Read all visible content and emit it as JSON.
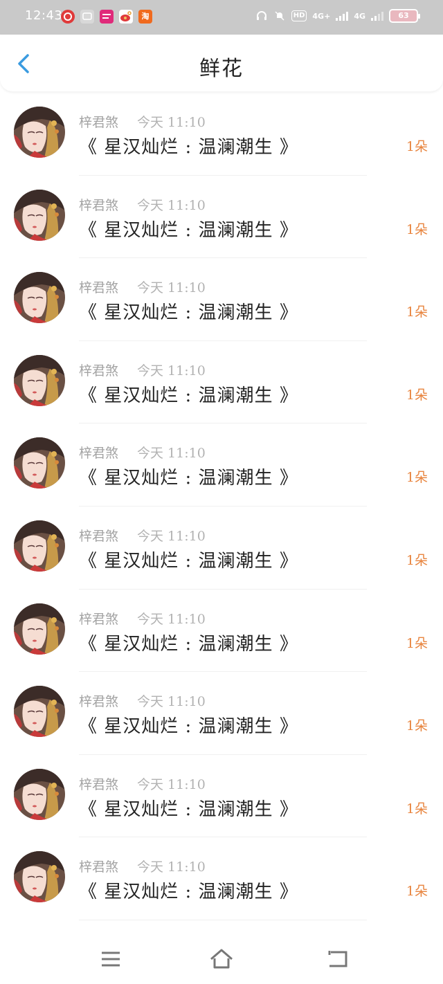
{
  "status_bar": {
    "time": "12:43",
    "apps": [
      {
        "icon": "netease-music-icon",
        "label": "",
        "color": "#e03a3a"
      },
      {
        "icon": "chat-app-icon",
        "label": "",
        "color": "#d8d8d8"
      },
      {
        "icon": "news-app-icon",
        "label": "",
        "color": "#e02a7a"
      },
      {
        "icon": "weibo-icon",
        "label": "",
        "color": "#e8a038"
      },
      {
        "icon": "taobao-icon",
        "label": "淘",
        "color": "#f06a1e"
      }
    ],
    "hd_label": "HD",
    "network_1": "4G+",
    "network_2": "4G",
    "battery": "63"
  },
  "header": {
    "title": "鲜花",
    "back_icon": "chevron-left-icon",
    "accent_color": "#3a9be0"
  },
  "list": {
    "items": [
      {
        "name": "梓君煞",
        "time": "今天 11:10",
        "title": "《 星汉灿烂 : 温澜潮生 》",
        "count": "1朵"
      },
      {
        "name": "梓君煞",
        "time": "今天 11:10",
        "title": "《 星汉灿烂 : 温澜潮生 》",
        "count": "1朵"
      },
      {
        "name": "梓君煞",
        "time": "今天 11:10",
        "title": "《 星汉灿烂 : 温澜潮生 》",
        "count": "1朵"
      },
      {
        "name": "梓君煞",
        "time": "今天 11:10",
        "title": "《 星汉灿烂 : 温澜潮生 》",
        "count": "1朵"
      },
      {
        "name": "梓君煞",
        "time": "今天 11:10",
        "title": "《 星汉灿烂 : 温澜潮生 》",
        "count": "1朵"
      },
      {
        "name": "梓君煞",
        "time": "今天 11:10",
        "title": "《 星汉灿烂 : 温澜潮生 》",
        "count": "1朵"
      },
      {
        "name": "梓君煞",
        "time": "今天 11:10",
        "title": "《 星汉灿烂 : 温澜潮生 》",
        "count": "1朵"
      },
      {
        "name": "梓君煞",
        "time": "今天 11:10",
        "title": "《 星汉灿烂 : 温澜潮生 》",
        "count": "1朵"
      },
      {
        "name": "梓君煞",
        "time": "今天 11:10",
        "title": "《 星汉灿烂 : 温澜潮生 》",
        "count": "1朵"
      },
      {
        "name": "梓君煞",
        "time": "今天 11:10",
        "title": "《 星汉灿烂 : 温澜潮生 》",
        "count": "1朵"
      }
    ],
    "count_color": "#e8843e"
  },
  "nav_bar": {
    "buttons": [
      "menu-icon",
      "home-icon",
      "back-icon"
    ]
  }
}
